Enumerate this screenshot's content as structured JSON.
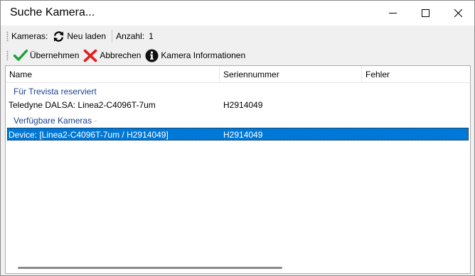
{
  "window": {
    "title": "Suche Kamera...",
    "minimize_icon": "minimize-icon",
    "maximize_icon": "maximize-icon",
    "close_icon": "close-icon"
  },
  "toolbar1": {
    "kameras_label": "Kameras:",
    "reload_icon": "refresh-icon",
    "reload_label": "Neu laden",
    "count_label": "Anzahl:",
    "count_value": "1"
  },
  "toolbar2": {
    "accept_icon": "checkmark-icon",
    "accept_label": "Übernehmen",
    "cancel_icon": "red-x-icon",
    "cancel_label": "Abbrechen",
    "info_icon": "info-icon",
    "info_label": "Kamera Informationen"
  },
  "grid": {
    "columns": [
      "Name",
      "Seriennummer",
      "Fehler"
    ],
    "groups": [
      {
        "title": "Für Trevista reserviert",
        "rows": [
          {
            "name": "Teledyne DALSA: Linea2-C4096T-7um",
            "serial": "H2914049",
            "error": "",
            "selected": false
          }
        ]
      },
      {
        "title": "Verfügbare Kameras",
        "rows": [
          {
            "name": "Device: [Linea2-C4096T-7um / H2914049]",
            "serial": "H2914049",
            "error": "",
            "selected": true
          }
        ]
      }
    ],
    "selection_color": "#0078d7",
    "group_title_color": "#1e3f8f"
  }
}
